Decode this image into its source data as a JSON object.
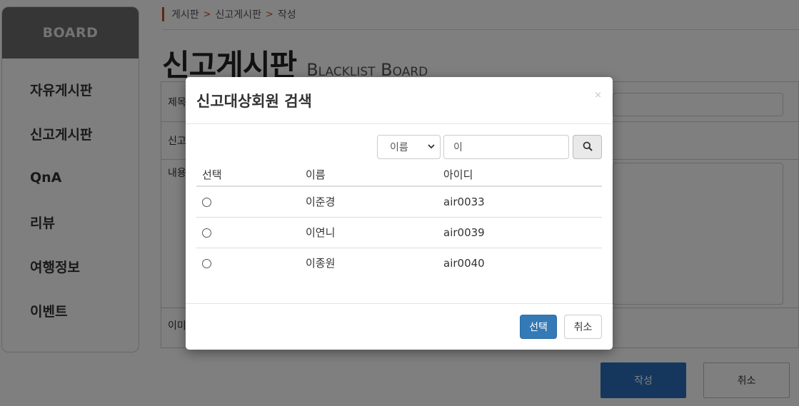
{
  "sidebar": {
    "header": "BOARD",
    "items": [
      {
        "label": "자유게시판"
      },
      {
        "label": "신고게시판"
      },
      {
        "label": "QnA"
      },
      {
        "label": "리뷰"
      },
      {
        "label": "여행정보"
      },
      {
        "label": "이벤트"
      }
    ]
  },
  "breadcrumb": [
    "게시판",
    "신고게시판",
    "작성"
  ],
  "page": {
    "title_ko": "신고게시판",
    "title_en": "Blacklist Board"
  },
  "form": {
    "labels": [
      "제목",
      "신고",
      "내용",
      "이미"
    ],
    "submit_label": "작성",
    "cancel_label": "취소"
  },
  "modal": {
    "title": "신고대상회원 검색",
    "close_symbol": "×",
    "search": {
      "field_option": "이름",
      "query": "이"
    },
    "table": {
      "headers": [
        "선택",
        "이름",
        "아이디"
      ],
      "rows": [
        {
          "name": "이준경",
          "id": "air0033"
        },
        {
          "name": "이연니",
          "id": "air0039"
        },
        {
          "name": "이종원",
          "id": "air0040"
        }
      ]
    },
    "select_label": "선택",
    "cancel_label": "취소"
  },
  "colors": {
    "accent": "#c0501e",
    "primary": "#337ab7",
    "sidebar_header": "#6d6d6d"
  }
}
